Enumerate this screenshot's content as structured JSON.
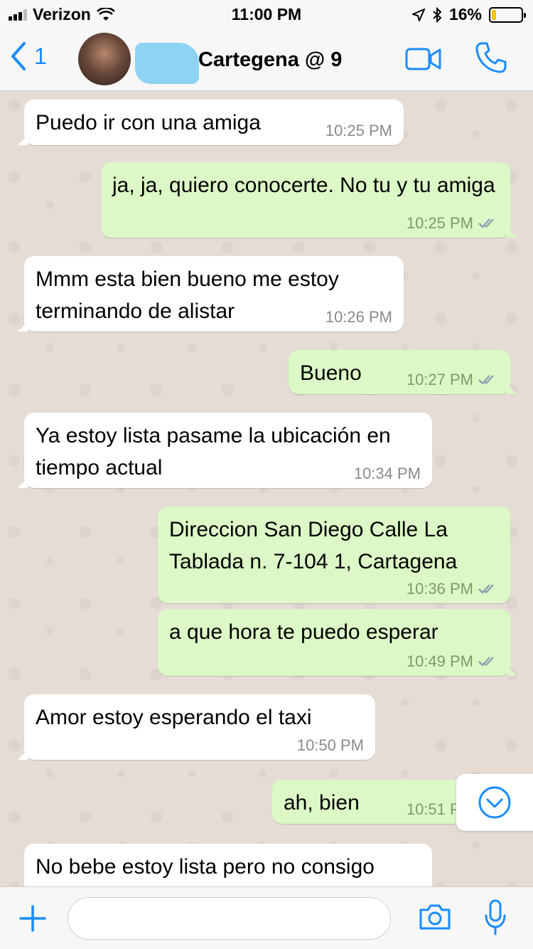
{
  "status_bar": {
    "carrier": "Verizon",
    "time": "11:00 PM",
    "battery": "16%",
    "battery_level": 0.16,
    "icons": [
      "signal-icon",
      "wifi-icon",
      "location-arrow-icon",
      "bluetooth-icon",
      "battery-icon"
    ]
  },
  "header": {
    "back_count": "1",
    "contact_name": "Cartegena @ 9",
    "icons": [
      "back-chevron-icon",
      "video-call-icon",
      "phone-call-icon"
    ]
  },
  "messages": [
    {
      "direction": "in",
      "text": "Puedo ir con una amiga",
      "time": "10:25 PM"
    },
    {
      "direction": "out",
      "text": "ja, ja, quiero conocerte. No tu y tu amiga",
      "time": "10:25 PM",
      "status": "read"
    },
    {
      "direction": "in",
      "text": "Mmm esta bien bueno me estoy terminando de alistar",
      "time": "10:26 PM"
    },
    {
      "direction": "out",
      "text": "Bueno",
      "time": "10:27 PM",
      "status": "read"
    },
    {
      "direction": "in",
      "text": "Ya estoy lista pasame la ubicación en tiempo actual",
      "time": "10:34 PM"
    },
    {
      "direction": "out",
      "text": "Direccion San Diego Calle La Tablada n. 7-104 1, Cartagena",
      "time": "10:36 PM",
      "status": "read"
    },
    {
      "direction": "out",
      "text": "a que hora te puedo esperar",
      "time": "10:49 PM",
      "status": "read"
    },
    {
      "direction": "in",
      "text": "Amor estoy esperando el taxi",
      "time": "10:50 PM"
    },
    {
      "direction": "out",
      "text": "ah, bien",
      "time": "10:51 PM",
      "status": "read"
    },
    {
      "direction": "in",
      "text": "No bebe estoy lista pero no consigo",
      "time": ""
    }
  ],
  "input": {
    "placeholder": "",
    "icons": [
      "plus-icon",
      "camera-icon",
      "microphone-icon"
    ]
  },
  "colors": {
    "accent": "#1a8cff",
    "outgoing_bubble": "#dcf8c6",
    "incoming_bubble": "#ffffff",
    "chat_background": "#e5ddd5",
    "read_ticks": "#7b9a6f"
  }
}
